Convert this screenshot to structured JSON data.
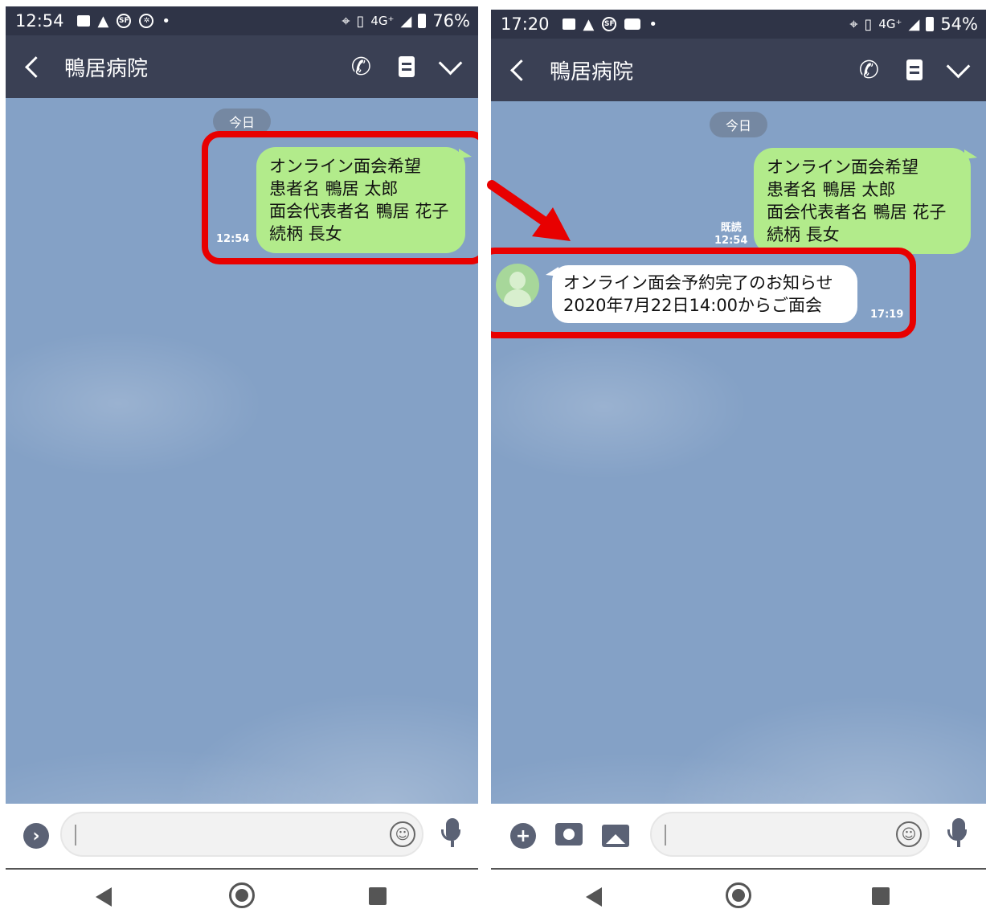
{
  "left": {
    "status": {
      "time": "12:54",
      "net": "4G⁺",
      "battery": "76%"
    },
    "header": {
      "title": "鴨居病院"
    },
    "chat": {
      "date": "今日",
      "sent": {
        "lines": [
          "オンライン面会希望",
          "患者名 鴨居 太郎",
          "面会代表者名 鴨居 花子",
          "続柄 長女"
        ],
        "time": "12:54"
      }
    }
  },
  "right": {
    "status": {
      "time": "17:20",
      "net": "4G⁺",
      "battery": "54%"
    },
    "header": {
      "title": "鴨居病院"
    },
    "chat": {
      "date": "今日",
      "sent": {
        "lines": [
          "オンライン面会希望",
          "患者名 鴨居 太郎",
          "面会代表者名 鴨居 花子",
          "続柄 長女"
        ],
        "read": "既読",
        "time": "12:54"
      },
      "received": {
        "lines": [
          "オンライン面会予約完了のお知らせ",
          "2020年7月22日14:00からご面会"
        ],
        "time": "17:19"
      }
    }
  },
  "icons": [
    "image-icon",
    "warning-icon",
    "sf-icon",
    "youtube-icon",
    "location-icon",
    "vibrate-icon",
    "signal-icon",
    "battery-icon",
    "phone-icon",
    "note-icon",
    "chevron-down-icon",
    "plus-icon",
    "camera-icon",
    "gallery-icon",
    "emoji-icon",
    "mic-icon"
  ],
  "colors": {
    "header": "#3a4054",
    "chat_bg": "#84a1c6",
    "sent_bubble": "#b2eb8b",
    "highlight": "#e80000"
  }
}
